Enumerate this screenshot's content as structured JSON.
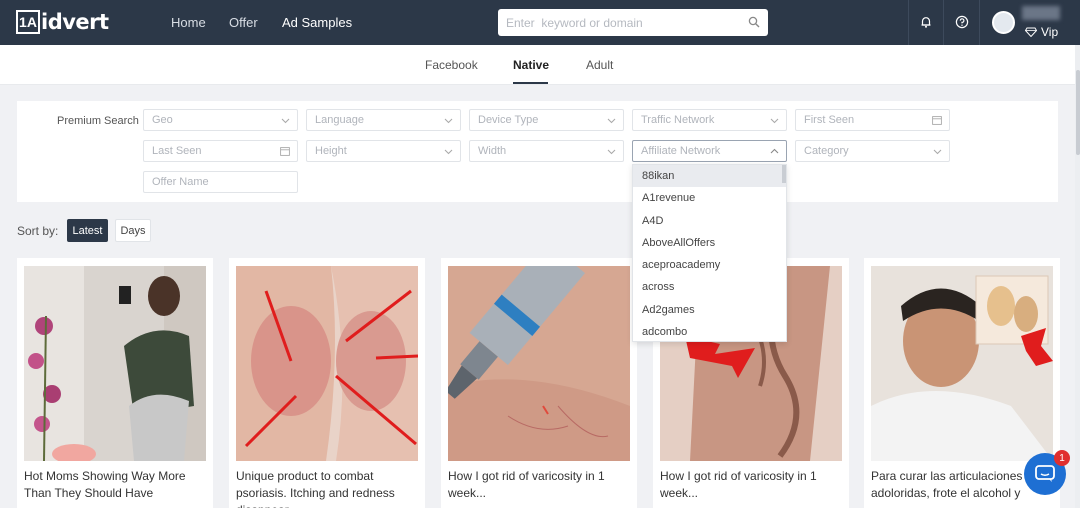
{
  "header": {
    "logo_mark": "1A",
    "logo_text": "idvert",
    "nav": [
      "Home",
      "Offer",
      "Ad Samples"
    ],
    "search_placeholder": "Enter  keyword or domain",
    "vip_label": "Vip"
  },
  "tabs": [
    "Facebook",
    "Native",
    "Adult"
  ],
  "filters": {
    "label": "Premium Search :",
    "fields": [
      "Geo",
      "Language",
      "Device Type",
      "Traffic Network",
      "First Seen",
      "Last Seen",
      "Height",
      "Width",
      "Affiliate Network",
      "Category",
      "Offer Name"
    ]
  },
  "dropdown": {
    "options": [
      "88ikan",
      "A1revenue",
      "A4D",
      "AboveAllOffers",
      "aceproacademy",
      "across",
      "Ad2games",
      "adcombo"
    ]
  },
  "sort": {
    "label": "Sort by:",
    "options": [
      "Latest",
      "Days"
    ]
  },
  "cards": [
    {
      "title": "Hot Moms Showing Way More Than They Should Have"
    },
    {
      "title": "Unique product to combat psoriasis. Itching and redness disappear"
    },
    {
      "title": "How I got rid of varicosity in 1 week..."
    },
    {
      "title": "How I got rid of varicosity in 1 week..."
    },
    {
      "title": "Para curar las articulaciones adoloridas, frote el alcohol y"
    }
  ],
  "chat": {
    "badge": "1"
  },
  "colors": {
    "navbar": "#2c3848",
    "accent": "#1e6fd3",
    "badge": "#e02f2f"
  }
}
